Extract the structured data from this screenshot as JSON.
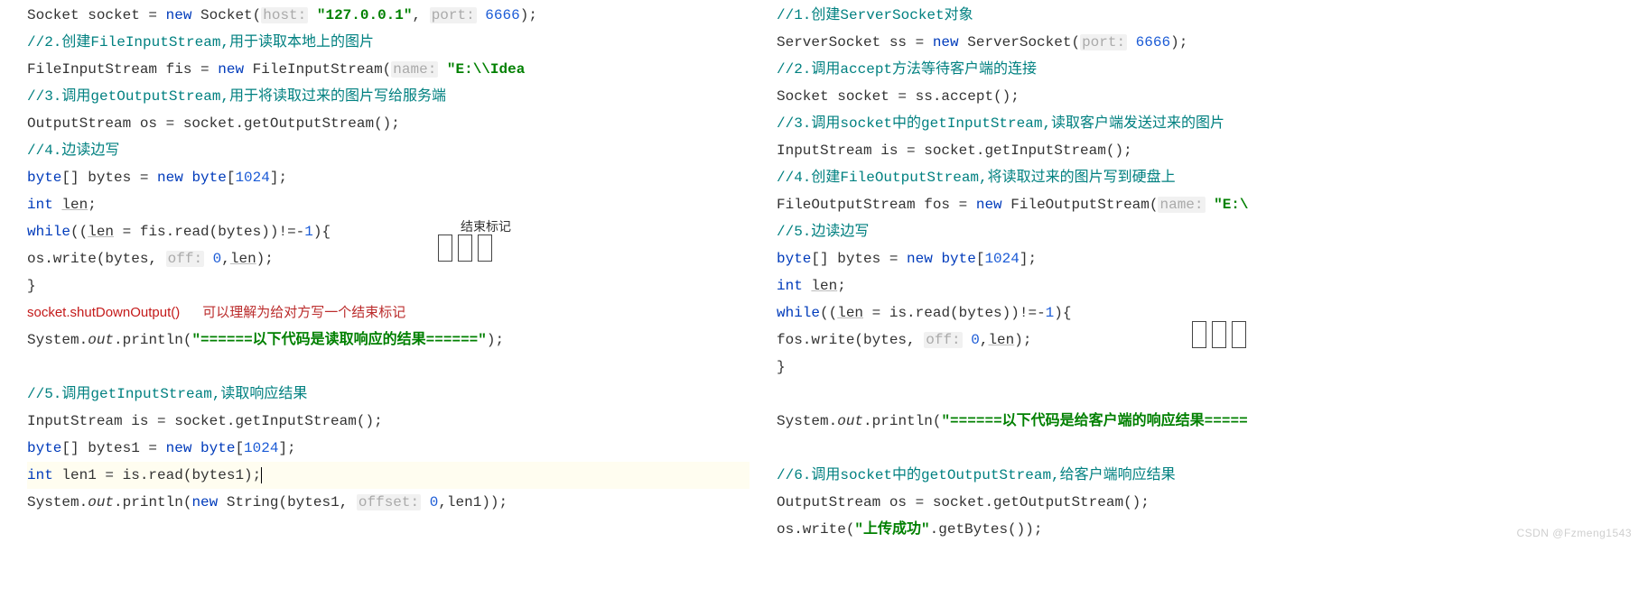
{
  "left": {
    "l1": {
      "p1": "Socket socket = ",
      "kw": "new",
      "p2": " Socket(",
      "hint1": "host:",
      "str1": " \"127.0.0.1\"",
      "comma": ", ",
      "hint2": "port:",
      "num1": " 6666",
      "close": ");"
    },
    "c2": "//2.创建FileInputStream,用于读取本地上的图片",
    "l3": {
      "p1": "FileInputStream fis = ",
      "kw": "new",
      "p2": " FileInputStream(",
      "hint": "name:",
      "str": " \"E:\\\\Idea"
    },
    "c4": "//3.调用getOutputStream,用于将读取过来的图片写给服务端",
    "l5": "OutputStream os = socket.getOutputStream();",
    "c6": "//4.边读边写",
    "l7": {
      "kw1": "byte",
      "p1": "[] bytes = ",
      "kw2": "new byte",
      "open": "[",
      "num": "1024",
      "close": "];"
    },
    "l8": {
      "kw": "int ",
      "var": "len",
      "end": ";"
    },
    "l9": {
      "kw": "while",
      "open": "((",
      "var": "len",
      "mid": " = fis.read(bytes))!=-",
      "num": "1",
      "close": "){"
    },
    "l10": {
      "indent": "     os.write(bytes,",
      "hint": "off:",
      "num": " 0",
      "comma": ",",
      "var": "len",
      "close": ");"
    },
    "l11": "}",
    "l12_red": "socket.shutDownOutput()",
    "l12_note": "可以理解为给对方写一个结束标记",
    "marker_label": "结束标记",
    "l13": {
      "p1": "System.",
      "out": "out",
      "p2": ".println(",
      "str": "\"======以下代码是读取响应的结果======\"",
      "close": ");"
    },
    "c14": "//5.调用getInputStream,读取响应结果",
    "l15": "InputStream is = socket.getInputStream();",
    "l16": {
      "kw1": "byte",
      "p1": "[] bytes1 = ",
      "kw2": "new byte",
      "open": "[",
      "num": "1024",
      "close": "];"
    },
    "l17": {
      "kw": "int",
      "p1": " len1 = is.read(bytes1);"
    },
    "l18": {
      "p1": "System.",
      "out": "out",
      "p2": ".println(",
      "kw": "new",
      "p3": " String(bytes1, ",
      "hint": "offset:",
      "num": " 0",
      "p4": ",len1));"
    }
  },
  "right": {
    "c1": "//1.创建ServerSocket对象",
    "l2": {
      "p1": "ServerSocket ss = ",
      "kw": "new",
      "p2": " ServerSocket(",
      "hint": "port:",
      "num": " 6666",
      "close": ");"
    },
    "c3": "//2.调用accept方法等待客户端的连接",
    "l4": "Socket socket = ss.accept();",
    "c5": "//3.调用socket中的getInputStream,读取客户端发送过来的图片",
    "l6": "InputStream is = socket.getInputStream();",
    "c7": "//4.创建FileOutputStream,将读取过来的图片写到硬盘上",
    "l8": {
      "p1": "FileOutputStream fos = ",
      "kw": "new",
      "p2": " FileOutputStream(",
      "hint": "name:",
      "str": " \"E:\\"
    },
    "c9": "//5.边读边写",
    "l10": {
      "kw1": "byte",
      "p1": "[] bytes = ",
      "kw2": "new byte",
      "open": "[",
      "num": "1024",
      "close": "];"
    },
    "l11": {
      "kw": "int ",
      "var": "len",
      "end": ";"
    },
    "l12": {
      "kw": "while",
      "open": "((",
      "var": "len",
      "mid": " = is.read(bytes))!=-",
      "num": "1",
      "close": "){"
    },
    "l13": {
      "indent": "     fos.write(bytes,",
      "hint": "off:",
      "num": " 0",
      "comma": ",",
      "var": "len",
      "close": ");"
    },
    "l14": "}",
    "l16": {
      "p1": "System.",
      "out": "out",
      "p2": ".println(",
      "str": "\"======以下代码是给客户端的响应结果=====",
      "close": ""
    },
    "c17": "//6.调用socket中的getOutputStream,给客户端响应结果",
    "l18": "OutputStream os = socket.getOutputStream();",
    "l19": {
      "p1": "os.write(",
      "str": "\"上传成功\"",
      "p2": ".getBytes());"
    }
  },
  "watermark": "CSDN @Fzmeng1543"
}
